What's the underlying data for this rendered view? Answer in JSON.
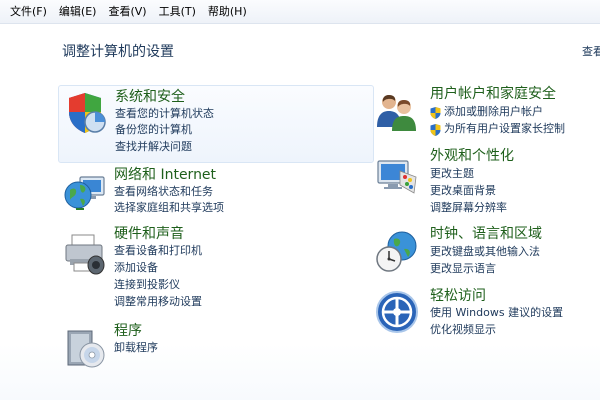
{
  "menubar": {
    "items": [
      "文件(F)",
      "编辑(E)",
      "查看(V)",
      "工具(T)",
      "帮助(H)"
    ]
  },
  "page": {
    "title": "调整计算机的设置",
    "view_label": "查看"
  },
  "left": [
    {
      "title": "系统和安全",
      "icon": "shield-icon",
      "links": [
        "查看您的计算机状态",
        "备份您的计算机",
        "查找并解决问题"
      ]
    },
    {
      "title": "网络和 Internet",
      "icon": "globe-network-icon",
      "links": [
        "查看网络状态和任务",
        "选择家庭组和共享选项"
      ]
    },
    {
      "title": "硬件和声音",
      "icon": "printer-icon",
      "links": [
        "查看设备和打印机",
        "添加设备",
        "连接到投影仪",
        "调整常用移动设置"
      ]
    },
    {
      "title": "程序",
      "icon": "disc-box-icon",
      "links": [
        "卸载程序"
      ]
    }
  ],
  "right": [
    {
      "title": "用户帐户和家庭安全",
      "icon": "users-icon",
      "links": [
        "添加或删除用户帐户",
        "为所有用户设置家长控制"
      ]
    },
    {
      "title": "外观和个性化",
      "icon": "monitor-palette-icon",
      "links": [
        "更改主题",
        "更改桌面背景",
        "调整屏幕分辨率"
      ]
    },
    {
      "title": "时钟、语言和区域",
      "icon": "clock-globe-icon",
      "links": [
        "更改键盘或其他输入法",
        "更改显示语言"
      ]
    },
    {
      "title": "轻松访问",
      "icon": "ease-of-access-icon",
      "links": [
        "使用 Windows 建议的设置",
        "优化视频显示"
      ]
    }
  ]
}
